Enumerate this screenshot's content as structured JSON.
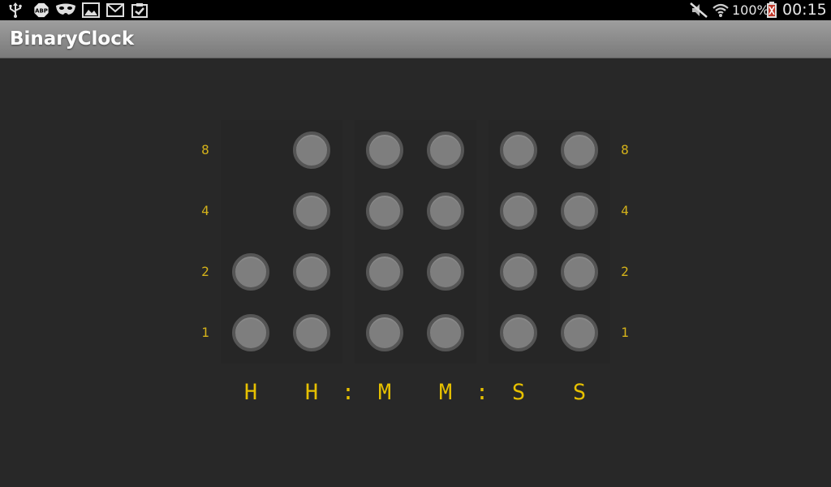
{
  "status_bar": {
    "battery": "100%",
    "time": "00:15",
    "icons": [
      "usb-icon",
      "adblock-plus-icon",
      "mask-icon",
      "gallery-icon",
      "gmail-icon",
      "clipboard-check-icon",
      "mute-icon",
      "wifi-icon",
      "battery-icon"
    ]
  },
  "app": {
    "title": "BinaryClock"
  },
  "clock": {
    "weights_left": [
      "8",
      "4",
      "2",
      "1"
    ],
    "weights_right": [
      "8",
      "4",
      "2",
      "1"
    ],
    "column_labels": [
      "H",
      "H",
      "M",
      "M",
      "S",
      "S"
    ],
    "separators": [
      ":",
      ":"
    ],
    "on_color": "#e5c200",
    "off_color": "#7e7e7e",
    "lit_bits": [
      [
        false,
        false
      ],
      [
        false,
        false,
        false,
        false
      ],
      [
        false,
        false,
        false,
        false
      ],
      [
        false,
        false,
        false,
        false
      ],
      [
        false,
        false,
        false,
        false
      ],
      [
        false,
        false,
        false,
        false
      ]
    ]
  }
}
